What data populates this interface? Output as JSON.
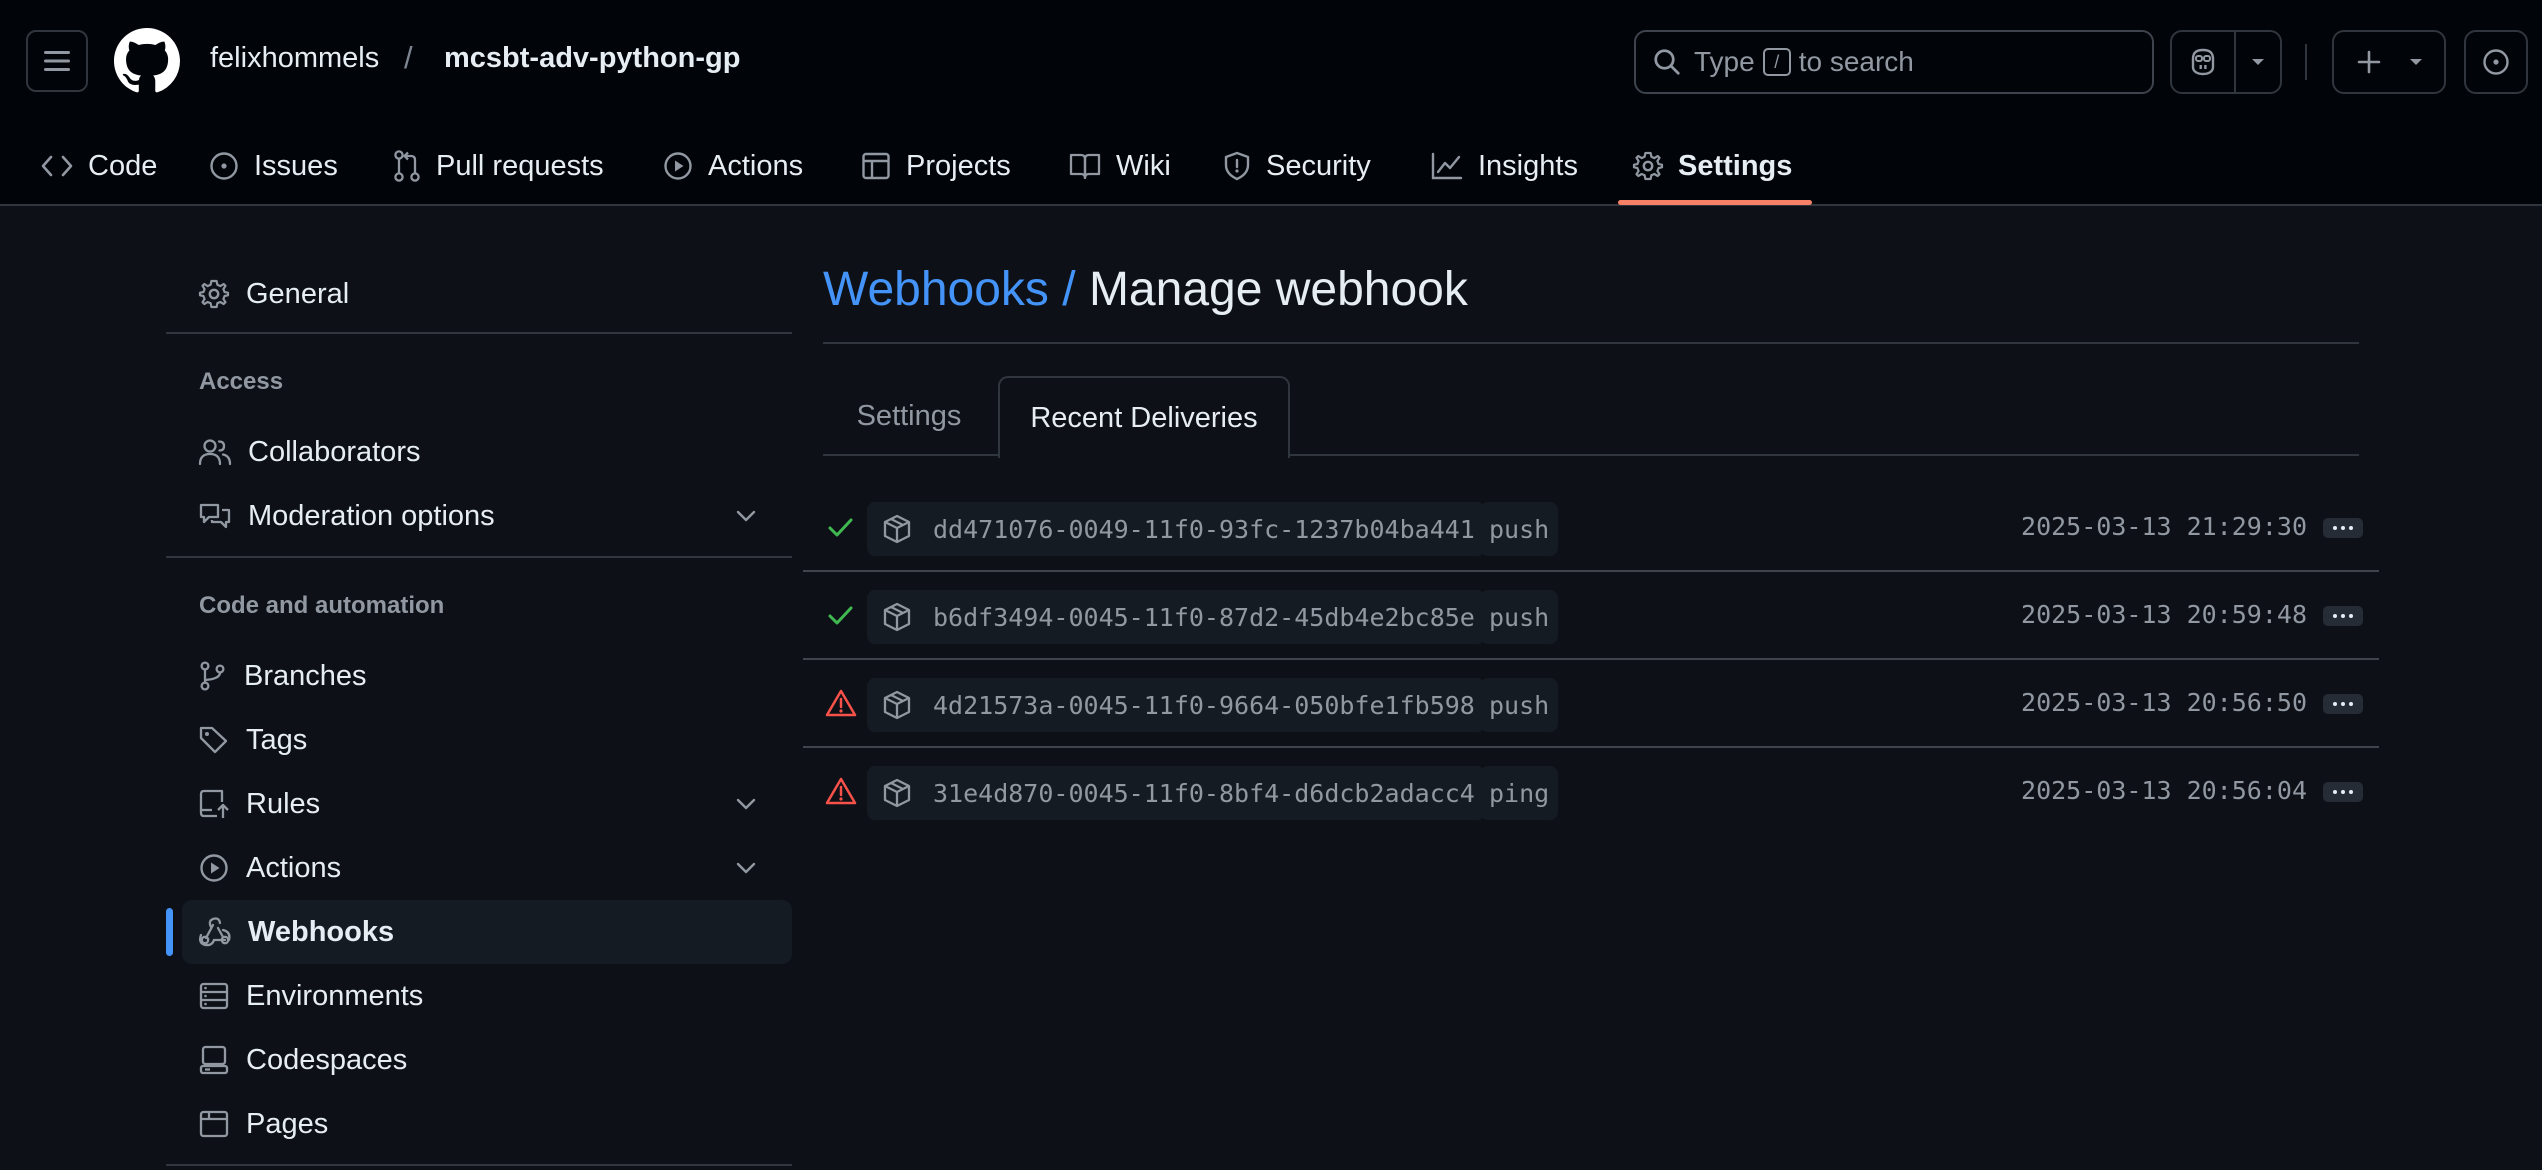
{
  "header": {
    "owner": "felixhommels",
    "separator": "/",
    "repo": "mcsbt-adv-python-gp",
    "search": {
      "prefix": "Type",
      "key": "/",
      "suffix": "to search"
    }
  },
  "nav": {
    "tabs": [
      {
        "label": "Code",
        "icon": "code-icon"
      },
      {
        "label": "Issues",
        "icon": "issue-opened-icon"
      },
      {
        "label": "Pull requests",
        "icon": "git-pull-request-icon"
      },
      {
        "label": "Actions",
        "icon": "play-icon"
      },
      {
        "label": "Projects",
        "icon": "table-icon"
      },
      {
        "label": "Wiki",
        "icon": "book-icon"
      },
      {
        "label": "Security",
        "icon": "shield-icon"
      },
      {
        "label": "Insights",
        "icon": "graph-icon"
      },
      {
        "label": "Settings",
        "icon": "gear-icon",
        "active": true
      }
    ],
    "accent": "#f78166"
  },
  "sidebar": {
    "general": "General",
    "access_heading": "Access",
    "collaborators": "Collaborators",
    "moderation": "Moderation options",
    "code_heading": "Code and automation",
    "branches": "Branches",
    "tags": "Tags",
    "rules": "Rules",
    "actions": "Actions",
    "webhooks": "Webhooks",
    "environments": "Environments",
    "codespaces": "Codespaces",
    "pages": "Pages"
  },
  "main": {
    "breadcrumb": "Webhooks /",
    "title": "Manage webhook",
    "tabs": {
      "settings": "Settings",
      "recent": "Recent Deliveries"
    },
    "deliveries": [
      {
        "status": "success",
        "guid": "dd471076-0049-11f0-93fc-1237b04ba441",
        "event": "push",
        "time": "2025-03-13 21:29:30"
      },
      {
        "status": "success",
        "guid": "b6df3494-0045-11f0-87d2-45db4e2bc85e",
        "event": "push",
        "time": "2025-03-13 20:59:48"
      },
      {
        "status": "failure",
        "guid": "4d21573a-0045-11f0-9664-050bfe1fb598",
        "event": "push",
        "time": "2025-03-13 20:56:50"
      },
      {
        "status": "failure",
        "guid": "31e4d870-0045-11f0-8bf4-d6dcb2adacc4",
        "event": "ping",
        "time": "2025-03-13 20:56:04"
      }
    ]
  },
  "colors": {
    "link": "#4493f8",
    "success": "#3fb950",
    "failure": "#f85149"
  }
}
